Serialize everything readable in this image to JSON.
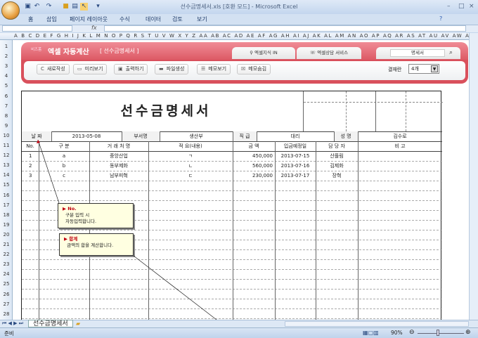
{
  "window": {
    "title": "선수금명세서.xls  [호환 모드] - Microsoft Excel",
    "minimize": "–",
    "maximize": "□",
    "close": "×"
  },
  "ribbon": {
    "tabs": [
      "홈",
      "삽입",
      "페이지 레이아웃",
      "수식",
      "데이터",
      "검토",
      "보기"
    ]
  },
  "formula": {
    "fx": "fx"
  },
  "columns": "A B C D E F G H I J K L M N O P Q R S T U V W X Y Z AA AB AC AD AE AF AG AH AI AJ AK AL AM AN AO AP AQ AR AS AT AU AV AW AX AY AZ BB BC",
  "rows": [
    "1",
    "2",
    "3",
    "4",
    "5",
    "6",
    "7",
    "8",
    "9",
    "10",
    "11",
    "12",
    "13",
    "14",
    "15",
    "16",
    "17",
    "18",
    "19",
    "20",
    "21",
    "22",
    "23",
    "24",
    "25",
    "26",
    "27",
    "28"
  ],
  "banner": {
    "brand_small": "비즈폼",
    "brand": "엑셀 자동계산",
    "doc_name": "[ 선수금명세서 ]",
    "tab1": "엑셀지식 IN",
    "tab2": "엑셀상담 서비스",
    "search_value": "명세서",
    "buttons": [
      "새로작성",
      "미리보기",
      "출력하기",
      "파일생성",
      "메모보기",
      "메모숨김"
    ],
    "approval_label": "결재란",
    "approval_value": "4개"
  },
  "form": {
    "title": "선수금명세서",
    "info": {
      "date_label": "날 짜",
      "date": "2013-05-08",
      "dept_label": "부서명",
      "dept": "생산부",
      "rank_label": "직 급",
      "rank": "대리",
      "name_label": "성 명",
      "name": "김수로"
    },
    "headers": [
      "No.",
      "구    분",
      "거 래 처 명",
      "적        요(내용)",
      "금    액",
      "입금예정일",
      "담 당 자",
      "비        고"
    ],
    "rows": [
      [
        "1",
        "a",
        "중앙산업",
        "ㄱ",
        "450,000",
        "2013-07-15",
        "산플림",
        ""
      ],
      [
        "2",
        "b",
        "동부제화",
        "ㄴ",
        "560,000",
        "2013-07-16",
        "김제화",
        ""
      ],
      [
        "3",
        "c",
        "남부피혁",
        "ㄷ",
        "230,000",
        "2013-07-17",
        "장혁",
        ""
      ]
    ]
  },
  "memos": [
    {
      "title": "▶ No.",
      "lines": [
        "구분 입력 시",
        "자동입력합니다."
      ]
    },
    {
      "title": "▶ 합계",
      "lines": [
        "금액의 합을 계산합니다."
      ]
    }
  ],
  "sheet_tab": "선수금명세서",
  "status": {
    "ready": "준비",
    "zoom": "90%"
  }
}
